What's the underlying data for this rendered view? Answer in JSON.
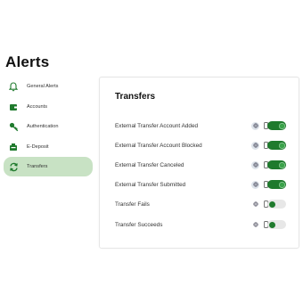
{
  "page": {
    "title": "Alerts"
  },
  "sidebar": {
    "items": [
      {
        "label": "General Alerts",
        "icon": "bell-icon"
      },
      {
        "label": "Accounts",
        "icon": "wallet-icon"
      },
      {
        "label": "Authentication",
        "icon": "key-icon"
      },
      {
        "label": "E-Deposit",
        "icon": "deposit-icon"
      },
      {
        "label": "Transfers",
        "icon": "transfer-icon",
        "active": true
      }
    ]
  },
  "transfers": {
    "title": "Transfers",
    "rows": [
      {
        "label": "External Transfer Account Added",
        "email_enabled": true,
        "toggle": "on"
      },
      {
        "label": "External Transfer Account Blocked",
        "email_enabled": true,
        "toggle": "on"
      },
      {
        "label": "External Transfer Canceled",
        "email_enabled": true,
        "toggle": "on"
      },
      {
        "label": "External Transfer Submitted",
        "email_enabled": true,
        "toggle": "on"
      },
      {
        "label": "Transfer Fails",
        "email_enabled": false,
        "toggle": "off"
      },
      {
        "label": "Transfer Succeeds",
        "email_enabled": false,
        "toggle": "off"
      }
    ]
  },
  "colors": {
    "accent": "#1f7a2d",
    "active_nav_bg": "#c8e2c4",
    "toggle_off": "#e7e7e7"
  }
}
